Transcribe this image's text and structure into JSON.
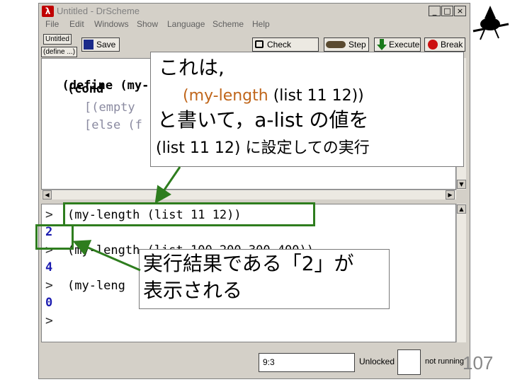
{
  "window": {
    "app_icon": "λ",
    "title": "Untitled - DrScheme",
    "buttons": [
      "_",
      "□",
      "×"
    ]
  },
  "menu": [
    "File",
    "Edit",
    "Windows",
    "Show",
    "Language",
    "Scheme",
    "Help"
  ],
  "toolbar": {
    "file_name": "Untitled",
    "define_menu": "(define ...)",
    "save": "Save",
    "check_syntax": "Check Syntax",
    "step": "Step",
    "execute": "Execute",
    "break": "Break"
  },
  "definitions": {
    "line1a": "(define (my-",
    "line2": "(cond",
    "line3": "[(empty",
    "line4": "[else (f"
  },
  "interactions": {
    "prompts": [
      ">",
      ">",
      ">",
      ">"
    ],
    "expr1": "(my-length (list 11 12))",
    "result1": "2",
    "expr2": "(my-length (list 100 200 300 400))",
    "result2": "4",
    "expr3": "(my-leng",
    "result3": "0"
  },
  "status": {
    "position": "9:3",
    "lock": "Unlocked",
    "running": "not running"
  },
  "callout_top": {
    "line1": "これは,",
    "line2": "(my-length (list 11 12))",
    "line3": "と書いて，a-list の値を",
    "line4": "(list 11 12) に設定しての実行"
  },
  "callout_bottom": {
    "line1": "実行結果である「2」が",
    "line2": "表示される"
  },
  "page_number": "107",
  "colors": {
    "highlight": "#2e7d1e",
    "result_blue": "#1c1cb0",
    "arrow_green": "#2e7d1e",
    "keyword_orange": "#c0661b"
  }
}
